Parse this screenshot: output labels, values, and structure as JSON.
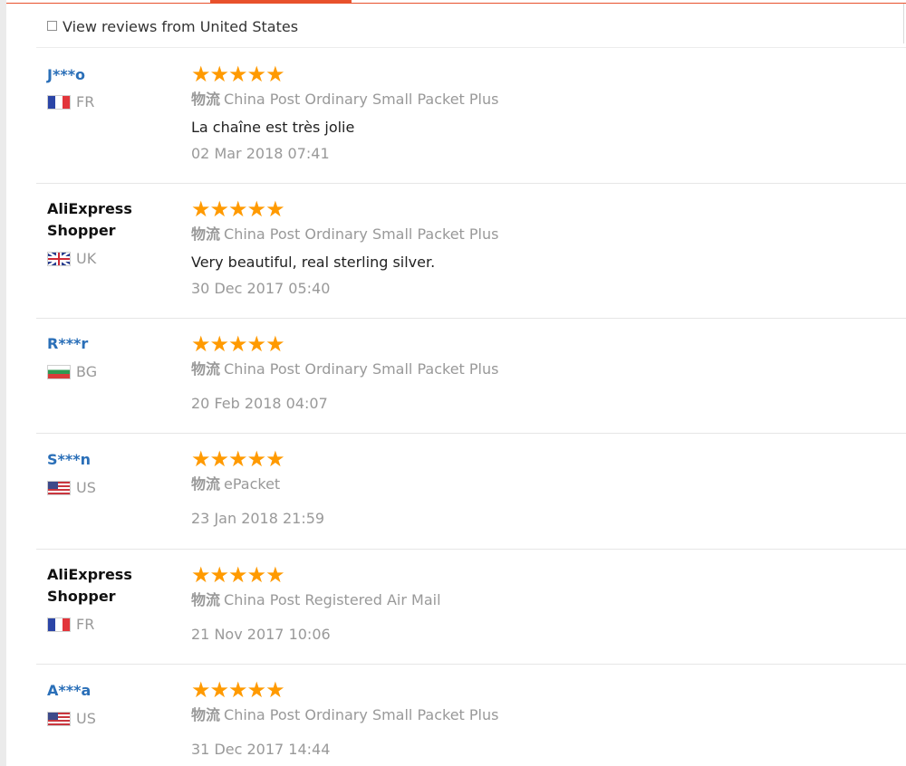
{
  "filter": {
    "label": "View reviews from United States",
    "checked": false
  },
  "shipping_label": "物流",
  "stars": "★★★★★",
  "reviews": [
    {
      "user": "J***o",
      "country": "FR",
      "flag": "flag-fr",
      "shipping": "China Post Ordinary Small Packet Plus",
      "comment": "La chaîne est très jolie",
      "date": "02 Mar 2018 07:41",
      "rating": 5
    },
    {
      "user": "AliExpress Shopper",
      "country": "UK",
      "flag": "flag-uk",
      "shipping": "China Post Ordinary Small Packet Plus",
      "comment": "Very beautiful, real sterling silver.",
      "date": "30 Dec 2017 05:40",
      "rating": 5
    },
    {
      "user": "R***r",
      "country": "BG",
      "flag": "flag-bg",
      "shipping": "China Post Ordinary Small Packet Plus",
      "comment": "",
      "date": "20 Feb 2018 04:07",
      "rating": 5
    },
    {
      "user": "S***n",
      "country": "US",
      "flag": "flag-us",
      "shipping": "ePacket",
      "comment": "",
      "date": "23 Jan 2018 21:59",
      "rating": 5
    },
    {
      "user": "AliExpress Shopper",
      "country": "FR",
      "flag": "flag-fr",
      "shipping": "China Post Registered Air Mail",
      "comment": "",
      "date": "21 Nov 2017 10:06",
      "rating": 5
    },
    {
      "user": "A***a",
      "country": "US",
      "flag": "flag-us",
      "shipping": "China Post Ordinary Small Packet Plus",
      "comment": "",
      "date": "31 Dec 2017 14:44",
      "rating": 5
    }
  ]
}
